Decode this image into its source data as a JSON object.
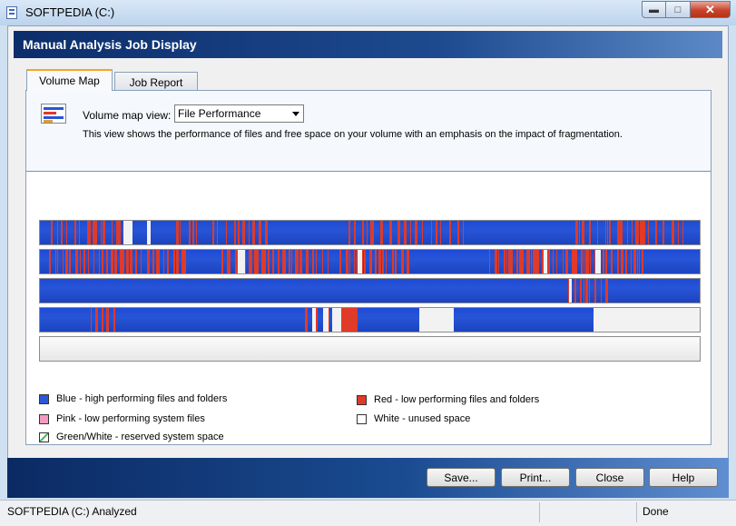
{
  "window": {
    "title": "SOFTPEDIA (C:)"
  },
  "header": {
    "title": "Manual Analysis Job Display"
  },
  "tabs": [
    {
      "label": "Volume Map",
      "active": true
    },
    {
      "label": "Job Report",
      "active": false
    }
  ],
  "volume_map": {
    "view_label": "Volume map view:",
    "selected_view": "File Performance",
    "description": "This view shows the performance of files and free space on your volume with an emphasis on the impact of fragmentation."
  },
  "legend": [
    {
      "label": "Blue - high performing files and folders",
      "color": "#2d57d8"
    },
    {
      "label": "Red - low performing files and folders",
      "color": "#e03a28"
    },
    {
      "label": "Pink - low performing system files",
      "color": "#f49ac2"
    },
    {
      "label": "White - unused space",
      "color": "#ffffff"
    },
    {
      "label": "Green/White - reserved system space",
      "color": "#9fd89f"
    }
  ],
  "buttons": {
    "save": "Save...",
    "print": "Print...",
    "close": "Close",
    "help": "Help"
  },
  "status": {
    "left": "SOFTPEDIA (C:) Analyzed",
    "right": "Done"
  },
  "colors": {
    "blue": "#2755d6",
    "red": "#e03a28",
    "white": "#f2f2f2"
  }
}
